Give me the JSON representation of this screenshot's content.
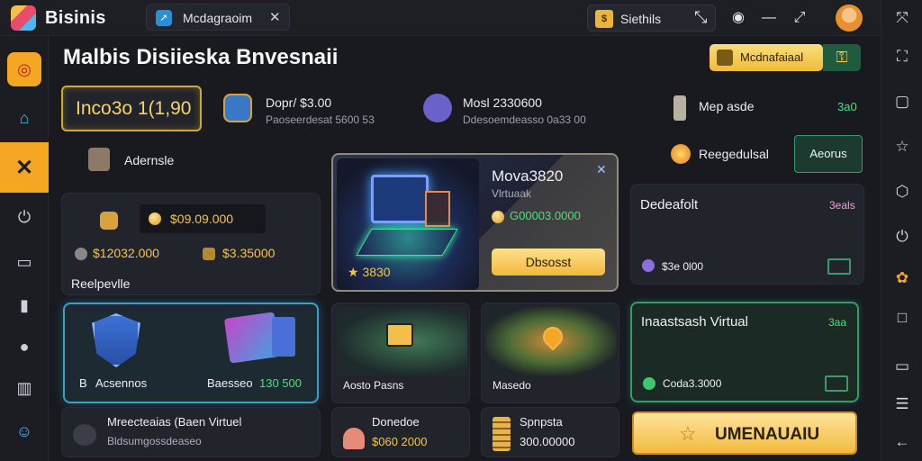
{
  "app": {
    "title": "Bisinis"
  },
  "tab": {
    "label": "Mcdagraoim",
    "icon": "arrow-icon"
  },
  "status": {
    "label": "Siethils"
  },
  "page_title": "Malbis Disiieska Bnvesnaii",
  "header_button": "Mcdnafaiaal",
  "balance": "Inco3o 1(1,90",
  "stats": [
    {
      "title": "Dopr/ $3.00",
      "sub": "Paoseerdesat 5600 53"
    },
    {
      "title": "Mosl 2330600",
      "sub": "Ddesoemdeasso 0a33 00"
    },
    {
      "title": "Mep asde",
      "value": "3a0"
    },
    {
      "title": "Reegedulsal",
      "button": "Aeorus"
    }
  ],
  "advertise_label": "Adernsle",
  "left_panel": {
    "amount_main": "$09.09.000",
    "amount_a": "$12032.000",
    "amount_b": "$3.35000",
    "footer": "Reelpevlle"
  },
  "feature": {
    "title": "Mova3820",
    "sub": "Vlrtuaak",
    "amount": "G00003.0000",
    "stars": "3830",
    "cta": "Dbsosst"
  },
  "deposit": {
    "title": "Dedeafolt",
    "value": "3eals",
    "amount": "$3e 0l00"
  },
  "security_card": {
    "left_label": "Acsennos",
    "left_prefix": "B",
    "right_label": "Baesseo",
    "right_value": "130 500"
  },
  "bottom_left": {
    "title": "Mreecteaias (Baen Virtuel",
    "sub": "Bldsumgossdeaseo"
  },
  "map1": {
    "label": "Aosto Pasns"
  },
  "map2": {
    "label": "Masedo"
  },
  "donate": {
    "title": "Donedoe",
    "value": "$060 2000"
  },
  "spnpsta": {
    "title": "Spnpsta",
    "value": "300.00000"
  },
  "invest_panel": {
    "title": "Inaastsash Virtual",
    "value": "3aa",
    "amount": "Coda3.3000"
  },
  "big_cta": "UMENAUAIU",
  "colors": {
    "accent": "#f5a623",
    "gold": "#f3c64a",
    "green": "#4ee07a",
    "glow_blue": "#3aa0c8"
  }
}
